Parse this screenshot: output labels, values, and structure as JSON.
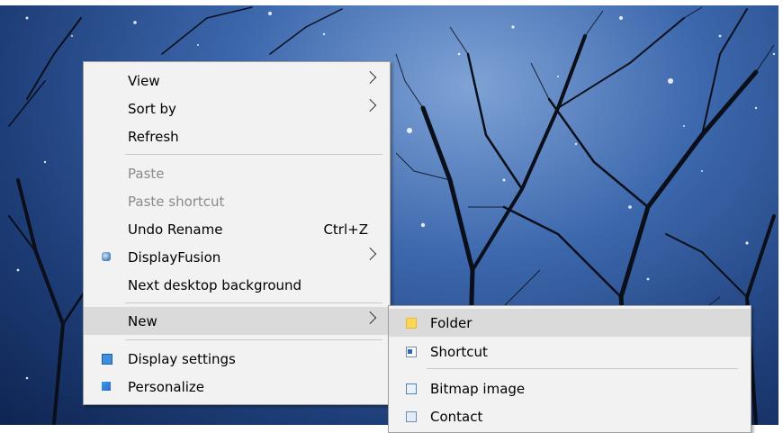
{
  "context_menu": {
    "items": [
      {
        "label": "View",
        "submenu": true
      },
      {
        "label": "Sort by",
        "submenu": true
      },
      {
        "label": "Refresh"
      },
      {
        "label": "Paste",
        "disabled": true
      },
      {
        "label": "Paste shortcut",
        "disabled": true
      },
      {
        "label": "Undo Rename",
        "shortcut": "Ctrl+Z"
      },
      {
        "label": "DisplayFusion",
        "submenu": true,
        "icon": "displayfusion-icon"
      },
      {
        "label": "Next desktop background"
      },
      {
        "label": "New",
        "submenu": true,
        "highlighted": true
      },
      {
        "label": "Display settings",
        "icon": "display-settings-icon"
      },
      {
        "label": "Personalize",
        "icon": "personalize-icon"
      }
    ]
  },
  "new_submenu": {
    "items": [
      {
        "label": "Folder",
        "icon": "folder-icon",
        "highlighted": true
      },
      {
        "label": "Shortcut",
        "icon": "shortcut-icon"
      },
      {
        "label": "Bitmap image",
        "icon": "bitmap-icon"
      },
      {
        "label": "Contact",
        "icon": "contact-icon"
      }
    ]
  },
  "colors": {
    "menu_background": "#f2f2f2",
    "highlight": "#dadada",
    "disabled_text": "#8a8a8a",
    "wallpaper": "#2b4f8e"
  }
}
